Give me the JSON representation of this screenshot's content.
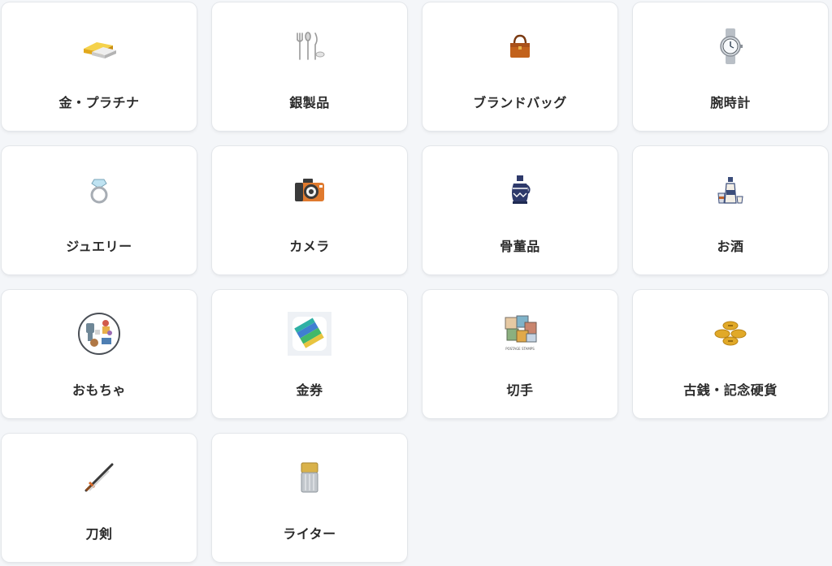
{
  "categories": [
    {
      "label": "金・プラチナ",
      "icon": "gold-bar-icon"
    },
    {
      "label": "銀製品",
      "icon": "silverware-icon"
    },
    {
      "label": "ブランドバッグ",
      "icon": "handbag-icon"
    },
    {
      "label": "腕時計",
      "icon": "wristwatch-icon"
    },
    {
      "label": "ジュエリー",
      "icon": "ring-icon"
    },
    {
      "label": "カメラ",
      "icon": "camera-icon"
    },
    {
      "label": "骨董品",
      "icon": "antique-vase-icon"
    },
    {
      "label": "お酒",
      "icon": "sake-bottles-icon"
    },
    {
      "label": "おもちゃ",
      "icon": "toys-icon"
    },
    {
      "label": "金券",
      "icon": "gift-cards-icon"
    },
    {
      "label": "切手",
      "icon": "stamps-icon",
      "icon_text": "POSTAGE STAMPS"
    },
    {
      "label": "古銭・記念硬貨",
      "icon": "coins-icon"
    },
    {
      "label": "刀剣",
      "icon": "katana-icon"
    },
    {
      "label": "ライター",
      "icon": "lighter-icon"
    }
  ]
}
